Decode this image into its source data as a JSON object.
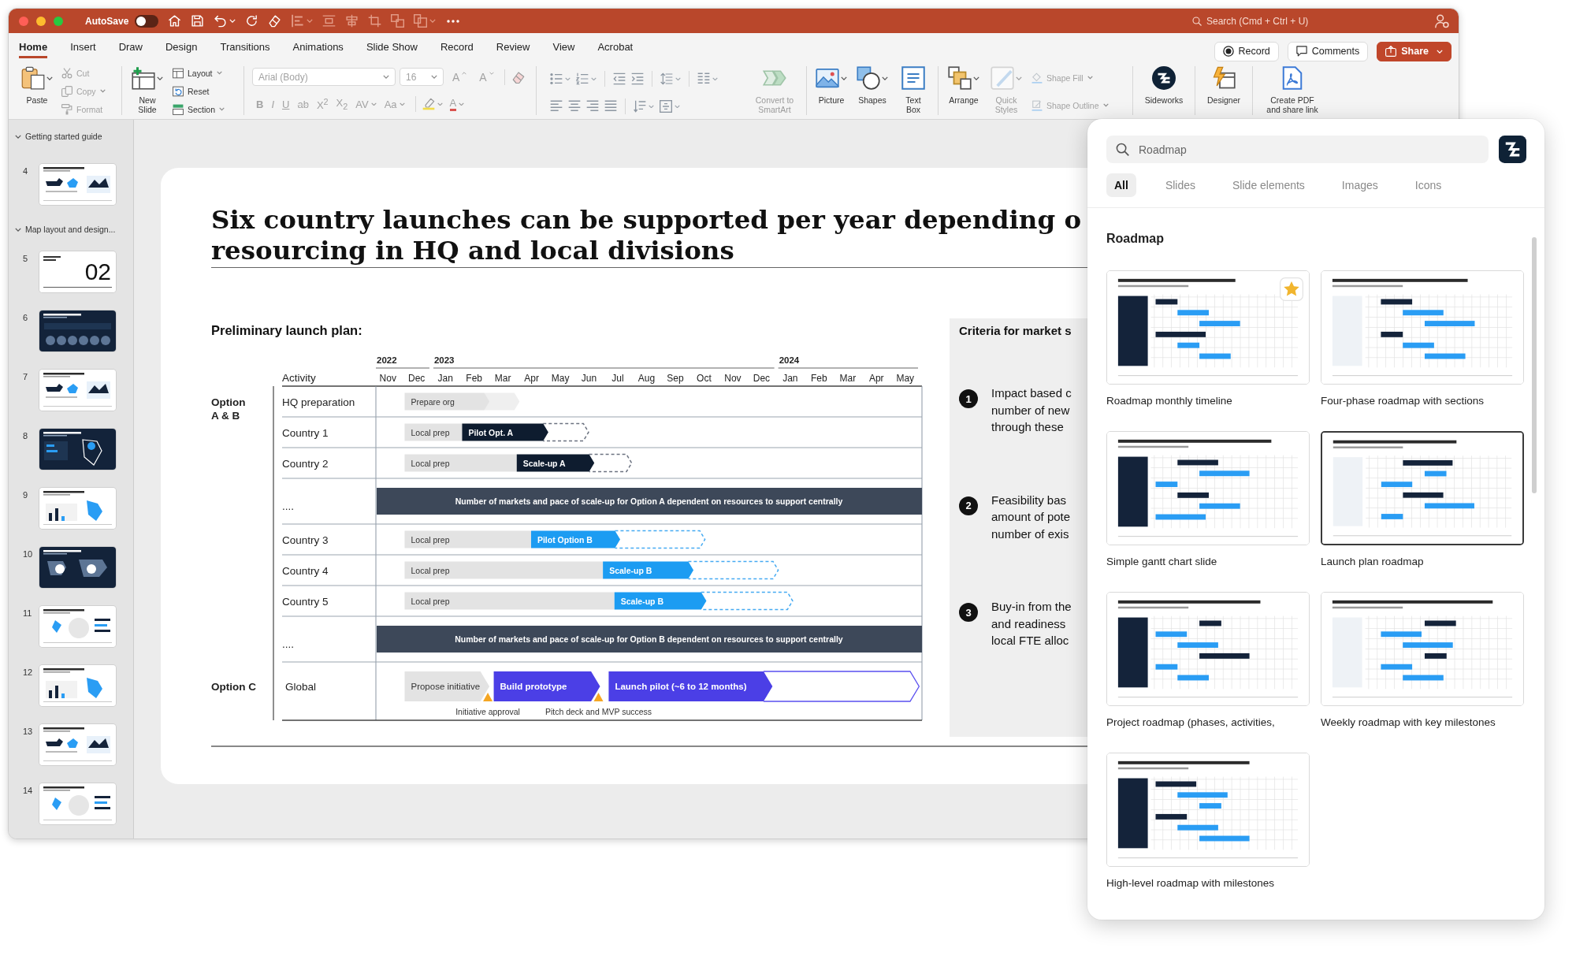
{
  "title_bar": {
    "autosave": {
      "label": "AutoSave",
      "on": false
    },
    "search": {
      "placeholder": "Search (Cmd + Ctrl + U)"
    }
  },
  "ribbon_tabs": [
    {
      "label": "Home",
      "selected": true
    },
    {
      "label": "Insert",
      "selected": false
    },
    {
      "label": "Draw",
      "selected": false
    },
    {
      "label": "Design",
      "selected": false
    },
    {
      "label": "Transitions",
      "selected": false
    },
    {
      "label": "Animations",
      "selected": false
    },
    {
      "label": "Slide Show",
      "selected": false
    },
    {
      "label": "Record",
      "selected": false
    },
    {
      "label": "Review",
      "selected": false
    },
    {
      "label": "View",
      "selected": false
    },
    {
      "label": "Acrobat",
      "selected": false
    }
  ],
  "ribbon_actions": [
    {
      "label": "Record",
      "kind": "record"
    },
    {
      "label": "Comments",
      "kind": "comments"
    },
    {
      "label": "Share",
      "kind": "share"
    }
  ],
  "ribbon": {
    "paste": {
      "label": "Paste"
    },
    "clipboard": [
      {
        "label": "Cut",
        "kind": "cut",
        "disabled": true
      },
      {
        "label": "Copy",
        "kind": "copy",
        "disabled": true
      },
      {
        "label": "Format",
        "kind": "format",
        "disabled": true
      }
    ],
    "new_slide": {
      "label": "New\nSlide"
    },
    "slide_tools": [
      {
        "label": "Layout",
        "kind": "layout",
        "disabled": false
      },
      {
        "label": "Reset",
        "kind": "reset",
        "disabled": false
      },
      {
        "label": "Section",
        "kind": "section",
        "disabled": false
      }
    ],
    "font": {
      "family": "Arial (Body)",
      "size": "16",
      "disabled": true,
      "size_buttons": [
        {
          "label": "A",
          "kind": "grow"
        },
        {
          "label": "A",
          "kind": "shrink"
        }
      ],
      "style_buttons": [
        {
          "label": "B",
          "kind": "bold"
        },
        {
          "label": "I",
          "kind": "italic"
        },
        {
          "label": "U",
          "kind": "underline"
        },
        {
          "label": "ab",
          "kind": "strike"
        },
        {
          "label": "X$^{2}$",
          "kind": "superscript"
        },
        {
          "label": "X$_{2}$",
          "kind": "subscript"
        },
        {
          "label": "AV",
          "kind": "spacing"
        },
        {
          "label": "Aa",
          "kind": "case"
        }
      ],
      "font_color": {
        "label": "A"
      }
    },
    "smartart": {
      "label": "Convert to\nSmartArt",
      "disabled": true
    },
    "insert": [
      {
        "label": "Picture",
        "kind": "picture"
      },
      {
        "label": "Shapes",
        "kind": "shapes"
      },
      {
        "label": "Text\nBox",
        "kind": "textbox"
      }
    ],
    "arrange": {
      "label": "Arrange"
    },
    "quick_styles": {
      "label": "Quick\nStyles",
      "disabled": true
    },
    "shape_format": [
      {
        "label": "Shape Fill",
        "kind": "fill",
        "disabled": true
      },
      {
        "label": "Shape Outline",
        "kind": "outline",
        "disabled": true
      }
    ],
    "addins": [
      {
        "label": "Sideworks",
        "kind": "sideworks"
      },
      {
        "label": "Designer",
        "kind": "designer"
      },
      {
        "label": "Create PDF\nand share link",
        "kind": "pdf"
      }
    ]
  },
  "slide_sections": [
    {
      "title": "Getting started guide",
      "expanded": true,
      "slides": [
        {
          "number": "4",
          "kind": "light",
          "selected": false
        }
      ]
    },
    {
      "title": "Map layout and design...",
      "expanded": true,
      "slides": [
        {
          "number": "5",
          "kind": "divider",
          "text": "02",
          "selected": false
        },
        {
          "number": "6",
          "kind": "dark",
          "selected": false
        },
        {
          "number": "7",
          "kind": "light",
          "selected": false
        },
        {
          "number": "8",
          "kind": "dark",
          "selected": false
        },
        {
          "number": "9",
          "kind": "light",
          "selected": false
        },
        {
          "number": "10",
          "kind": "dark",
          "selected": false
        },
        {
          "number": "11",
          "kind": "light",
          "selected": false
        },
        {
          "number": "12",
          "kind": "light",
          "selected": false
        },
        {
          "number": "13",
          "kind": "light",
          "selected": false
        },
        {
          "number": "14",
          "kind": "light",
          "selected": false
        }
      ]
    }
  ],
  "slide": {
    "title": "Six country launches can be supported per year depending o\nresourcing in HQ and local divisions",
    "plan": {
      "title": "Preliminary launch plan:",
      "column_header": "Activity",
      "timeline": [
        {
          "year": "2022",
          "months": [
            "Nov",
            "Dec"
          ]
        },
        {
          "year": "2023",
          "months": [
            "Jan",
            "Feb",
            "Mar",
            "Apr",
            "May",
            "Jun",
            "Jul",
            "Aug",
            "Sep",
            "Oct",
            "Nov",
            "Dec"
          ]
        },
        {
          "year": "2024",
          "months": [
            "Jan",
            "Feb",
            "Mar",
            "Apr",
            "May"
          ]
        }
      ],
      "groups": [
        {
          "label": "Option\nA & B",
          "rows": [
            {
              "label": "HQ preparation",
              "kind": "bars",
              "bars": [
                {
                  "label": "Prepare org",
                  "kind": "grey"
                }
              ]
            },
            {
              "label": "Country 1",
              "kind": "bars",
              "bars": [
                {
                  "label": "Local prep",
                  "kind": "grey"
                },
                {
                  "label": "Pilot Opt. A",
                  "kind": "dark"
                }
              ]
            },
            {
              "label": "Country 2",
              "kind": "bars",
              "bars": [
                {
                  "label": "Local prep",
                  "kind": "grey"
                },
                {
                  "label": "Scale-up A",
                  "kind": "dark"
                }
              ]
            },
            {
              "label": "....",
              "kind": "banner",
              "text": "Number of markets and pace of scale-up for Option A dependent on resources to support centrally"
            },
            {
              "label": "Country 3",
              "kind": "bars",
              "bars": [
                {
                  "label": "Local prep",
                  "kind": "grey"
                },
                {
                  "label": "Pilot Option B",
                  "kind": "blue"
                }
              ]
            },
            {
              "label": "Country 4",
              "kind": "bars",
              "bars": [
                {
                  "label": "Local prep",
                  "kind": "grey"
                },
                {
                  "label": "Scale-up B",
                  "kind": "blue"
                }
              ]
            },
            {
              "label": "Country 5",
              "kind": "bars",
              "bars": [
                {
                  "label": "Local prep",
                  "kind": "grey"
                },
                {
                  "label": "Scale-up B",
                  "kind": "blue"
                }
              ]
            },
            {
              "label": "....",
              "kind": "banner",
              "text": "Number of markets and pace of scale-up for Option B dependent on resources to support centrally"
            }
          ]
        },
        {
          "label": "Option C",
          "rows": [
            {
              "label": "Global",
              "kind": "bars",
              "bars": [
                {
                  "label": "Propose initiative",
                  "kind": "grey"
                },
                {
                  "label": "Build prototype",
                  "kind": "purple"
                },
                {
                  "label": "Launch pilot (~6 to 12 months)",
                  "kind": "purple"
                }
              ],
              "milestones": [
                {
                  "label": "Initiative approval"
                },
                {
                  "label": "Pitch deck and MVP success"
                }
              ]
            }
          ]
        }
      ]
    },
    "criteria": {
      "heading": "Criteria for market s",
      "items": [
        {
          "number": "1",
          "text": "Impact based c\nnumber of new\nthrough these"
        },
        {
          "number": "2",
          "text": "Feasibility bas\namount of pote\nnumber of exis"
        },
        {
          "number": "3",
          "text": "Buy-in from the\nand readiness\nlocal FTE alloc"
        }
      ]
    }
  },
  "search_panel": {
    "search": {
      "value": "Roadmap"
    },
    "tabs": [
      {
        "label": "All",
        "selected": true
      },
      {
        "label": "Slides",
        "selected": false
      },
      {
        "label": "Slide elements",
        "selected": false
      },
      {
        "label": "Images",
        "selected": false
      },
      {
        "label": "Icons",
        "selected": false
      }
    ],
    "section_title": "Roadmap",
    "results": [
      {
        "caption": "Roadmap monthly timeline",
        "favorite": true,
        "selected": false
      },
      {
        "caption": "Four-phase roadmap with sections",
        "favorite": false,
        "selected": false
      },
      {
        "caption": "Simple gantt chart slide",
        "favorite": false,
        "selected": false
      },
      {
        "caption": "Launch plan roadmap",
        "favorite": false,
        "selected": true
      },
      {
        "caption": "Project roadmap (phases, activities,",
        "favorite": false,
        "selected": false
      },
      {
        "caption": "Weekly roadmap with key milestones",
        "favorite": false,
        "selected": false
      },
      {
        "caption": "High-level roadmap with milestones",
        "favorite": false,
        "selected": false
      }
    ]
  }
}
